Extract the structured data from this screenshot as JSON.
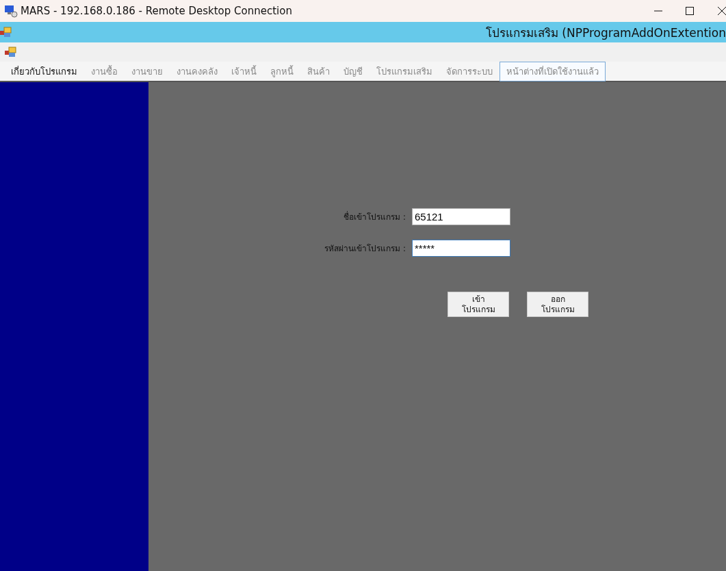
{
  "window": {
    "title": "MARS - 192.168.0.186 - Remote Desktop Connection"
  },
  "app_bar": {
    "title": "โปรแกรมเสริม (NPProgramAddOnExtention"
  },
  "menu": [
    {
      "label": "เกี่ยวกับโปรแกรม",
      "disabled": false,
      "selected": false
    },
    {
      "label": "งานซื้อ",
      "disabled": true,
      "selected": false
    },
    {
      "label": "งานขาย",
      "disabled": true,
      "selected": false
    },
    {
      "label": "งานคงคลัง",
      "disabled": true,
      "selected": false
    },
    {
      "label": "เจ้าหนี้",
      "disabled": true,
      "selected": false
    },
    {
      "label": "ลูกหนี้",
      "disabled": true,
      "selected": false
    },
    {
      "label": "สินค้า",
      "disabled": true,
      "selected": false
    },
    {
      "label": "บัญชี",
      "disabled": true,
      "selected": false
    },
    {
      "label": "โปรแกรมเสริม",
      "disabled": true,
      "selected": false
    },
    {
      "label": "จัดการระบบ",
      "disabled": true,
      "selected": false
    },
    {
      "label": "หน้าต่างที่เปิดใช้งานแล้ว",
      "disabled": true,
      "selected": true
    }
  ],
  "login": {
    "fields": [
      {
        "label": "ชื่อเข้าโปรแกรม :",
        "value": "65121",
        "focused": false
      },
      {
        "label": "รหัสผ่านเข้าโปรแกรม :",
        "value": "*****",
        "focused": true
      }
    ],
    "buttons": [
      {
        "lines": [
          "เข้า",
          "โปรแกรม"
        ]
      },
      {
        "lines": [
          "ออก",
          "โปรแกรม"
        ]
      }
    ]
  }
}
